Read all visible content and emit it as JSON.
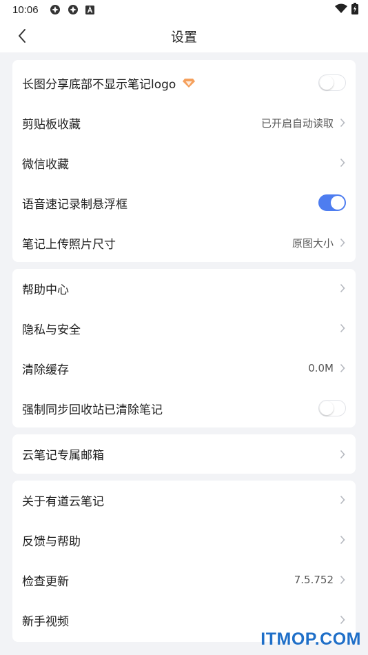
{
  "statusbar": {
    "time": "10:06"
  },
  "header": {
    "title": "设置"
  },
  "groups": [
    {
      "items": [
        {
          "label": "长图分享底部不显示笔记logo",
          "toggle": false,
          "premium": true
        },
        {
          "label": "剪贴板收藏",
          "value": "已开启自动读取"
        },
        {
          "label": "微信收藏"
        },
        {
          "label": "语音速记录制悬浮框",
          "toggle": true
        },
        {
          "label": "笔记上传照片尺寸",
          "value": "原图大小"
        }
      ]
    },
    {
      "items": [
        {
          "label": "帮助中心"
        },
        {
          "label": "隐私与安全"
        },
        {
          "label": "清除缓存",
          "value": "0.0M"
        },
        {
          "label": "强制同步回收站已清除笔记",
          "toggle": false
        }
      ]
    },
    {
      "items": [
        {
          "label": "云笔记专属邮箱"
        }
      ]
    },
    {
      "items": [
        {
          "label": "关于有道云笔记"
        },
        {
          "label": "反馈与帮助"
        },
        {
          "label": "检查更新",
          "value": "7.5.752"
        },
        {
          "label": "新手视频"
        }
      ]
    }
  ],
  "watermark": "ITMOP.COM",
  "colors": {
    "accent": "#4e7df0",
    "premium": "#f5a05c",
    "background": "#f2f3f6"
  }
}
